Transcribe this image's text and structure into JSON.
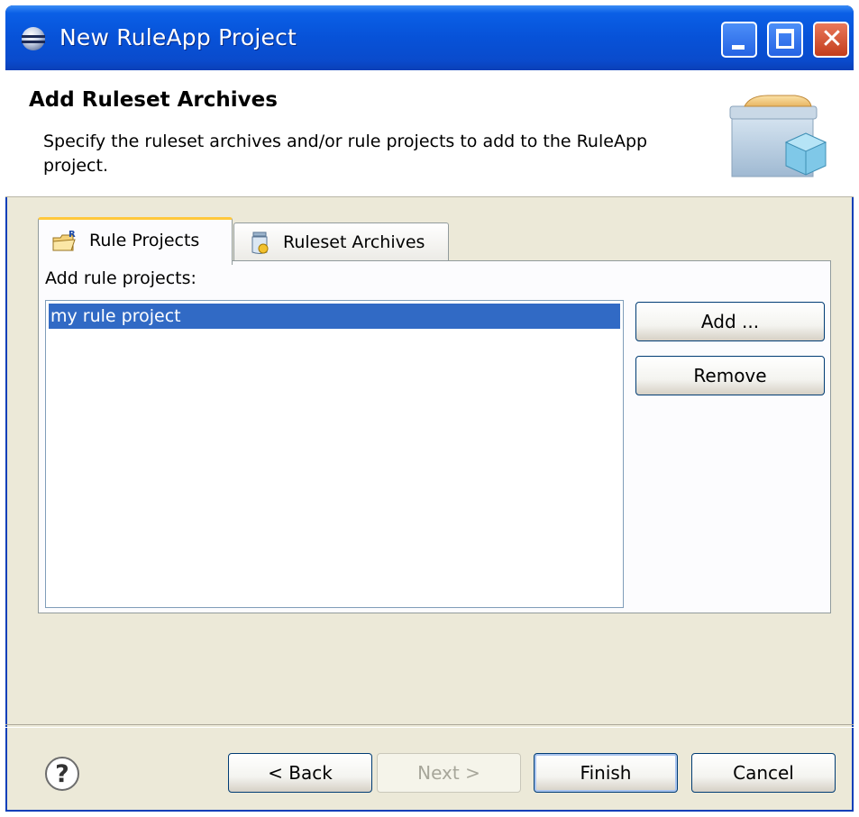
{
  "window": {
    "title": "New RuleApp Project"
  },
  "header": {
    "title": "Add Ruleset Archives",
    "description": "Specify the ruleset archives and/or rule projects to add to the RuleApp project."
  },
  "tabs": [
    {
      "label": "Rule Projects",
      "icon": "rule-project-folder-icon",
      "active": true
    },
    {
      "label": "Ruleset Archives",
      "icon": "ruleset-archive-jar-icon",
      "active": false
    }
  ],
  "panel": {
    "label": "Add rule projects:",
    "items": [
      "my rule project"
    ],
    "add_label": "Add ...",
    "remove_label": "Remove"
  },
  "footer": {
    "back_label": "< Back",
    "next_label": "Next >",
    "finish_label": "Finish",
    "cancel_label": "Cancel"
  },
  "colors": {
    "titlebar": "#0752d8",
    "selection": "#316ac5",
    "dialog_bg": "#ece9d8",
    "active_tab_accent": "#ffc83c"
  }
}
